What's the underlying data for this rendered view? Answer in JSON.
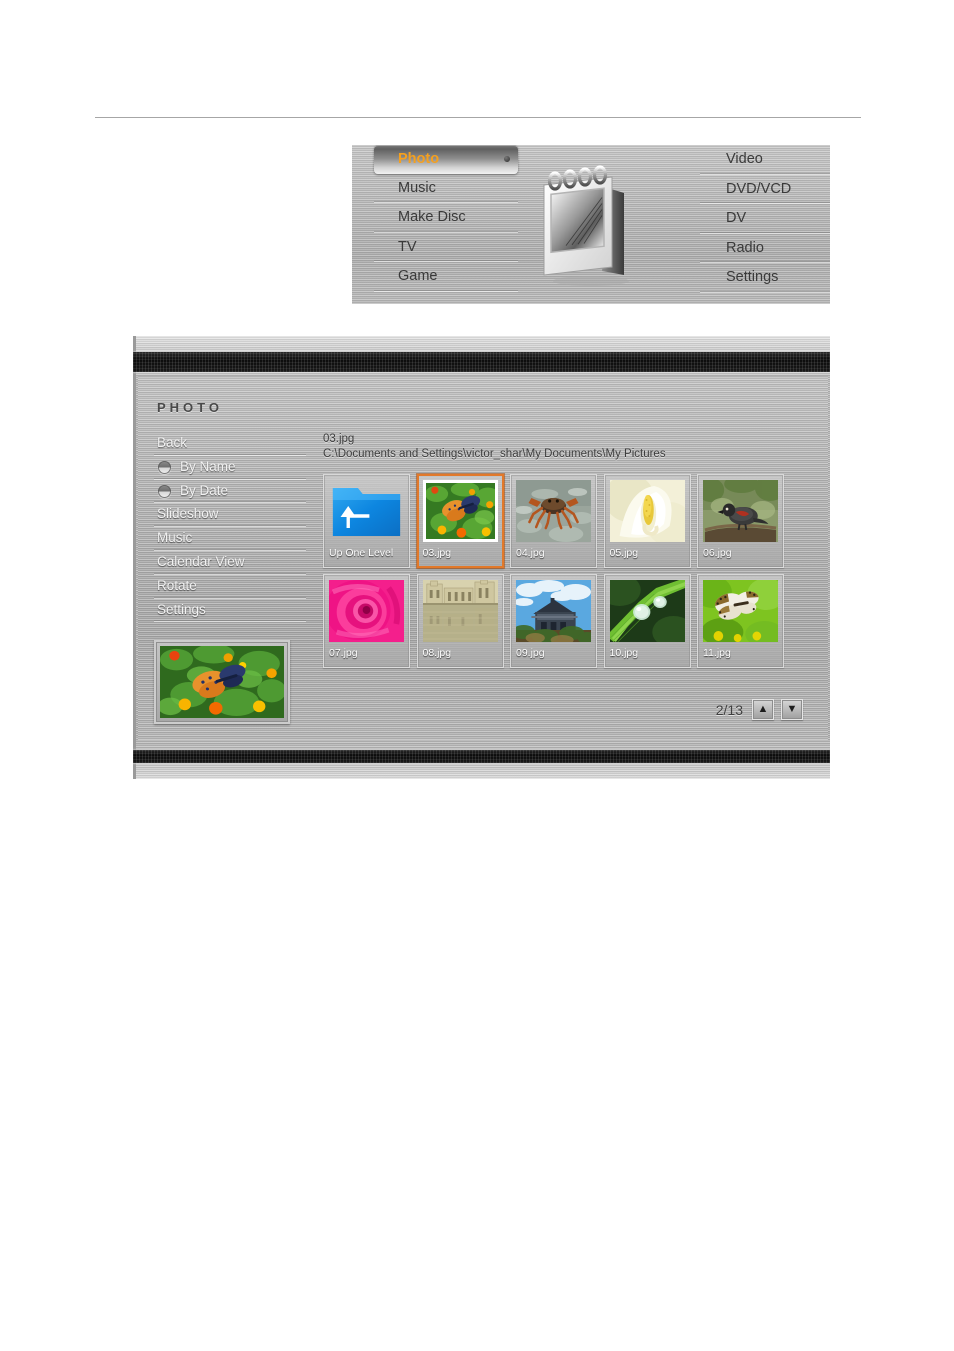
{
  "top_menu": {
    "left_items": [
      {
        "label": "Photo",
        "selected": true
      },
      {
        "label": "Music",
        "selected": false
      },
      {
        "label": "Make Disc",
        "selected": false
      },
      {
        "label": "TV",
        "selected": false
      },
      {
        "label": "Game",
        "selected": false
      }
    ],
    "right_items": [
      {
        "label": "Video",
        "selected": false
      },
      {
        "label": "DVD/VCD",
        "selected": false
      },
      {
        "label": "DV",
        "selected": false
      },
      {
        "label": "Radio",
        "selected": false
      },
      {
        "label": "Settings",
        "selected": false
      }
    ],
    "center_graphic": "desk-calendar-photo-frame",
    "highlight_color": "#f5a01e"
  },
  "photo_app": {
    "logo": "Photo",
    "sidebar": [
      {
        "label": "Back",
        "type": "item"
      },
      {
        "label": "By Name",
        "type": "radio"
      },
      {
        "label": "By Date",
        "type": "radio"
      },
      {
        "label": "Slideshow",
        "type": "item"
      },
      {
        "label": "Music",
        "type": "item"
      },
      {
        "label": "Calendar View",
        "type": "item"
      },
      {
        "label": "Rotate",
        "type": "item"
      },
      {
        "label": "Settings",
        "type": "item"
      }
    ],
    "file_name": "03.jpg",
    "file_path": "C:\\Documents and Settings\\victor_shar\\My Documents\\My Pictures",
    "preview_image": "butterfly-on-marigolds",
    "selection_color": "#e2792a",
    "thumbnails": [
      {
        "label": "Up One Level",
        "kind": "folder-up",
        "selected": false
      },
      {
        "label": "03.jpg",
        "kind": "butterfly-on-marigolds",
        "selected": true
      },
      {
        "label": "04.jpg",
        "kind": "crab-on-sand",
        "selected": false
      },
      {
        "label": "05.jpg",
        "kind": "white-calla-lily",
        "selected": false
      },
      {
        "label": "06.jpg",
        "kind": "bird-on-branch",
        "selected": false
      },
      {
        "label": "07.jpg",
        "kind": "pink-rose",
        "selected": false
      },
      {
        "label": "08.jpg",
        "kind": "building-reflection-in-water",
        "selected": false
      },
      {
        "label": "09.jpg",
        "kind": "old-house-blue-sky",
        "selected": false
      },
      {
        "label": "10.jpg",
        "kind": "dew-drops-on-leaf",
        "selected": false
      },
      {
        "label": "11.jpg",
        "kind": "butterfly-on-green",
        "selected": false
      }
    ],
    "pager": {
      "text": "2/13",
      "up_label": "▲",
      "down_label": "▼"
    }
  }
}
